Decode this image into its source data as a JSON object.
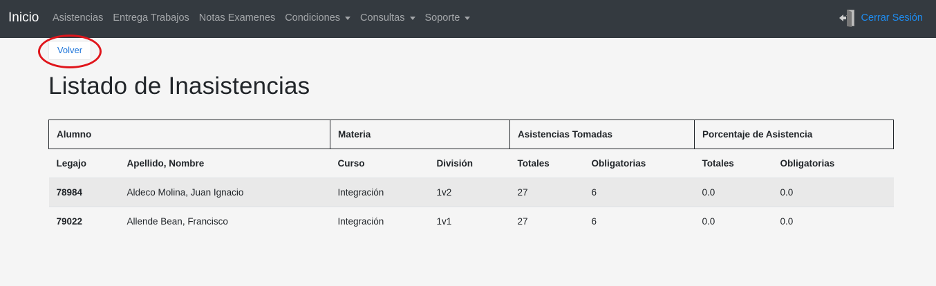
{
  "navbar": {
    "brand": "Inicio",
    "links": [
      {
        "label": "Asistencias",
        "dropdown": false
      },
      {
        "label": "Entrega Trabajos",
        "dropdown": false
      },
      {
        "label": "Notas Examenes",
        "dropdown": false
      },
      {
        "label": "Condiciones",
        "dropdown": true
      },
      {
        "label": "Consultas",
        "dropdown": true
      },
      {
        "label": "Soporte",
        "dropdown": true
      }
    ],
    "logout_label": "Cerrar Sesión",
    "logout_icon": "door-exit-icon",
    "background": "#343a40",
    "link_color": "#1e8cf0"
  },
  "back_button": {
    "label": "Volver"
  },
  "highlight": {
    "color": "#e0151b"
  },
  "page_title": "Listado de Inasistencias",
  "table": {
    "groups": [
      "Alumno",
      "Materia",
      "Asistencias Tomadas",
      "Porcentaje de Asistencia"
    ],
    "columns": [
      "Legajo",
      "Apellido, Nombre",
      "Curso",
      "División",
      "Totales",
      "Obligatorias",
      "Totales",
      "Obligatorias"
    ],
    "rows": [
      [
        "78984",
        "Aldeco Molina, Juan Ignacio",
        "Integración",
        "1v2",
        "27",
        "6",
        "0.0",
        "0.0"
      ],
      [
        "79022",
        "Allende Bean, Francisco",
        "Integración",
        "1v1",
        "27",
        "6",
        "0.0",
        "0.0"
      ]
    ]
  }
}
